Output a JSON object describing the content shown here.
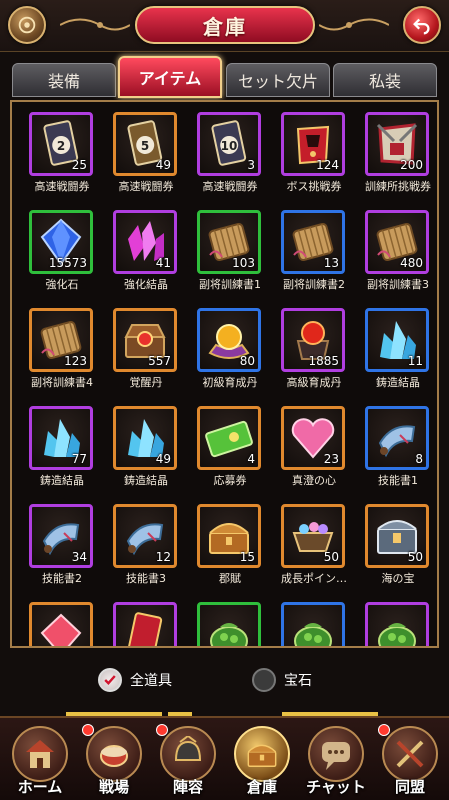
{
  "header": {
    "title": "倉庫",
    "left_icon": "menu-icon",
    "right_icon": "back-arrow-icon"
  },
  "tabs": [
    {
      "label": "装備",
      "active": false
    },
    {
      "label": "アイテム",
      "active": true
    },
    {
      "label": "セット欠片",
      "active": false
    },
    {
      "label": "私装",
      "active": false
    }
  ],
  "items": [
    {
      "name": "高速戦闘券",
      "count": "25",
      "rarity": "purple",
      "icon": "ticket-2-icon"
    },
    {
      "name": "高速戦闘券",
      "count": "49",
      "rarity": "orange",
      "icon": "ticket-5-icon"
    },
    {
      "name": "高速戦闘券",
      "count": "3",
      "rarity": "purple",
      "icon": "ticket-10-icon"
    },
    {
      "name": "ボス挑戦券",
      "count": "124",
      "rarity": "purple",
      "icon": "boss-challenge-ticket-icon"
    },
    {
      "name": "訓練所挑戦券",
      "count": "200",
      "rarity": "purple",
      "icon": "training-challenge-ticket-icon"
    },
    {
      "name": "強化石",
      "count": "15573",
      "rarity": "green",
      "icon": "blue-crystal-icon"
    },
    {
      "name": "強化結晶",
      "count": "41",
      "rarity": "purple",
      "icon": "pink-crystal-icon"
    },
    {
      "name": "副将訓練書1",
      "count": "103",
      "rarity": "green",
      "icon": "bamboo-scroll-icon"
    },
    {
      "name": "副将訓練書2",
      "count": "13",
      "rarity": "blue",
      "icon": "bamboo-scroll-icon"
    },
    {
      "name": "副将訓練書3",
      "count": "480",
      "rarity": "purple",
      "icon": "bamboo-scroll-icon"
    },
    {
      "name": "副将訓練書4",
      "count": "123",
      "rarity": "orange",
      "icon": "bamboo-scroll-icon"
    },
    {
      "name": "覚醒丹",
      "count": "557",
      "rarity": "orange",
      "icon": "treasure-box-pill-icon"
    },
    {
      "name": "初級育成丹",
      "count": "80",
      "rarity": "blue",
      "icon": "golden-pill-icon"
    },
    {
      "name": "高級育成丹",
      "count": "1885",
      "rarity": "purple",
      "icon": "red-pill-cauldron-icon"
    },
    {
      "name": "鋳造結晶",
      "count": "11",
      "rarity": "blue",
      "icon": "cyan-crystal-icon"
    },
    {
      "name": "鋳造結晶",
      "count": "77",
      "rarity": "purple",
      "icon": "cyan-crystal-icon"
    },
    {
      "name": "鋳造結晶",
      "count": "49",
      "rarity": "orange",
      "icon": "cyan-crystal-icon"
    },
    {
      "name": "応募券",
      "count": "4",
      "rarity": "orange",
      "icon": "green-coupon-icon"
    },
    {
      "name": "真澄の心",
      "count": "23",
      "rarity": "orange",
      "icon": "pink-heart-gem-icon"
    },
    {
      "name": "技能書1",
      "count": "8",
      "rarity": "blue",
      "icon": "skill-scroll-icon"
    },
    {
      "name": "技能書2",
      "count": "34",
      "rarity": "purple",
      "icon": "skill-scroll-icon"
    },
    {
      "name": "技能書3",
      "count": "12",
      "rarity": "orange",
      "icon": "skill-scroll-icon"
    },
    {
      "name": "郡賦",
      "count": "15",
      "rarity": "orange",
      "icon": "treasure-chest-icon"
    },
    {
      "name": "成長ポイン…",
      "count": "50",
      "rarity": "orange",
      "icon": "gem-cart-icon"
    },
    {
      "name": "海の宝",
      "count": "50",
      "rarity": "orange",
      "icon": "silver-chest-icon"
    },
    {
      "name": "",
      "count": "",
      "rarity": "orange",
      "icon": "red-gem-icon"
    },
    {
      "name": "",
      "count": "",
      "rarity": "purple",
      "icon": "card-icon"
    },
    {
      "name": "",
      "count": "",
      "rarity": "green",
      "icon": "money-bag-icon"
    },
    {
      "name": "",
      "count": "",
      "rarity": "blue",
      "icon": "money-bag-icon"
    },
    {
      "name": "",
      "count": "",
      "rarity": "purple",
      "icon": "money-bag-icon"
    }
  ],
  "filter": {
    "all_items_label": "全道具",
    "gems_label": "宝石"
  },
  "nav": [
    {
      "label": "ホーム",
      "icon": "home-building-icon",
      "active": false,
      "badge": false
    },
    {
      "label": "戦場",
      "icon": "war-drum-icon",
      "active": false,
      "badge": true
    },
    {
      "label": "陣容",
      "icon": "helmet-icon",
      "active": false,
      "badge": true
    },
    {
      "label": "倉庫",
      "icon": "treasure-chest-icon",
      "active": true,
      "badge": false
    },
    {
      "label": "チャット",
      "icon": "chat-bubble-icon",
      "active": false,
      "badge": false
    },
    {
      "label": "同盟",
      "icon": "alliance-weapon-icon",
      "active": false,
      "badge": true
    }
  ],
  "colors": {
    "purple": "#b03ee0",
    "orange": "#e0892e",
    "green": "#2fbf3c",
    "blue": "#2f74e6",
    "accent_red": "#d7263d",
    "gold": "#e6c47e"
  }
}
